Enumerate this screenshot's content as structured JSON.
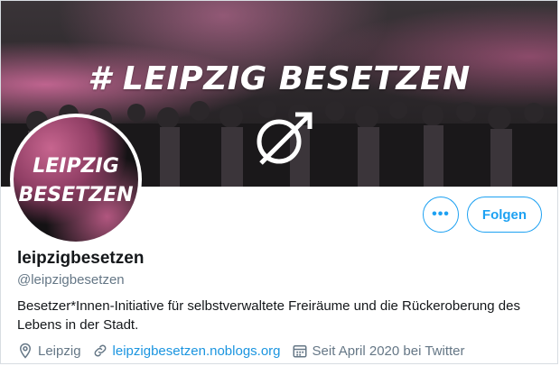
{
  "banner": {
    "title": "# LEIPZIG BESETZEN"
  },
  "avatar": {
    "line1": "LEIPZIG",
    "line2": "BESETZEN"
  },
  "actions": {
    "more_label": "•••",
    "follow_label": "Folgen"
  },
  "profile": {
    "display_name": "leipzigbesetzen",
    "handle": "@leipzigbesetzen",
    "bio": "Besetzer*Innen-Initiative für selbstverwaltete Freiräume und die Rückeroberung des Lebens in der Stadt.",
    "location": "Leipzig",
    "website": "leipzigbesetzen.noblogs.org",
    "joined": "Seit April 2020 bei Twitter"
  },
  "icons": {
    "location": "location-pin-icon",
    "link": "link-icon",
    "calendar": "calendar-icon"
  },
  "colors": {
    "accent": "#1da1f2",
    "link": "#1b95e0",
    "secondary_text": "#657786",
    "banner_pink": "#d86ea0"
  }
}
